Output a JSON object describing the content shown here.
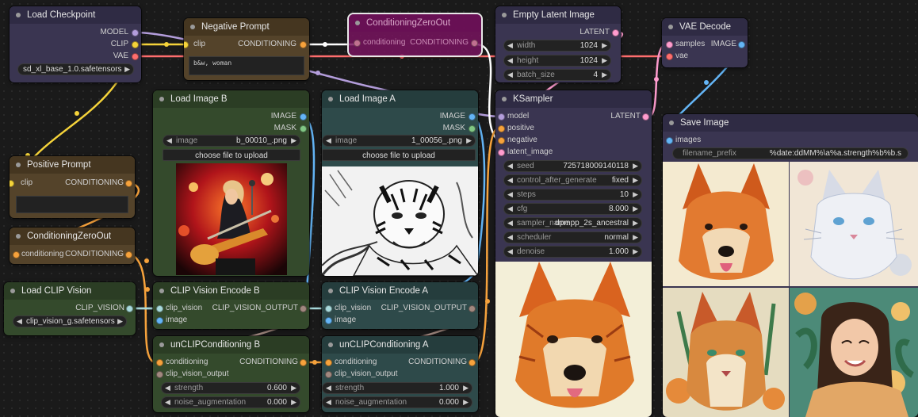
{
  "colors": {
    "clip": "#f5d33a",
    "conditioning": "#f6a23c",
    "model": "#b39ddb",
    "vae": "#ff6e6e",
    "latent": "#ff9ccf",
    "image": "#64b5f6",
    "mask": "#81c784",
    "clip_vision": "#a8dadc",
    "clip_vision_output": "#a1887f"
  },
  "load_checkpoint": {
    "title": "Load Checkpoint",
    "outputs": [
      "MODEL",
      "CLIP",
      "VAE"
    ],
    "ckpt_value": "sd_xl_base_1.0.safetensors"
  },
  "negative_prompt": {
    "title": "Negative Prompt",
    "input": "clip",
    "output": "CONDITIONING",
    "text": "b&w, woman"
  },
  "zero_out_top": {
    "title": "ConditioningZeroOut",
    "input": "conditioning",
    "output": "CONDITIONING"
  },
  "empty_latent": {
    "title": "Empty Latent Image",
    "output": "LATENT",
    "widgets": [
      {
        "name": "width",
        "value": "1024"
      },
      {
        "name": "height",
        "value": "1024"
      },
      {
        "name": "batch_size",
        "value": "4"
      }
    ]
  },
  "vae_decode": {
    "title": "VAE Decode",
    "inputs": [
      "samples",
      "vae"
    ],
    "output": "IMAGE"
  },
  "load_image_b": {
    "title": "Load Image B",
    "outputs": [
      "IMAGE",
      "MASK"
    ],
    "image_name": "image",
    "image_value": "b_00010_.png",
    "upload_label": "choose file to upload"
  },
  "load_image_a": {
    "title": "Load Image A",
    "outputs": [
      "IMAGE",
      "MASK"
    ],
    "image_name": "image",
    "image_value": "1_00056_.png",
    "upload_label": "choose file to upload"
  },
  "ksampler": {
    "title": "KSampler",
    "inputs": [
      "model",
      "positive",
      "negative",
      "latent_image"
    ],
    "output": "LATENT",
    "widgets": [
      {
        "name": "seed",
        "value": "725718009140118"
      },
      {
        "name": "control_after_generate",
        "value": "fixed"
      },
      {
        "name": "steps",
        "value": "10"
      },
      {
        "name": "cfg",
        "value": "8.000"
      },
      {
        "name": "sampler_name",
        "value": "dpmpp_2s_ancestral"
      },
      {
        "name": "scheduler",
        "value": "normal"
      },
      {
        "name": "denoise",
        "value": "1.000"
      }
    ]
  },
  "save_image": {
    "title": "Save Image",
    "input": "images",
    "prefix_name": "filename_prefix",
    "prefix_value": "%date:ddMM%\\a%a.strength%b%b.s"
  },
  "positive_prompt": {
    "title": "Positive Prompt",
    "input": "clip",
    "output": "CONDITIONING"
  },
  "zero_out_left": {
    "title": "ConditioningZeroOut",
    "input": "conditioning",
    "output": "CONDITIONING"
  },
  "load_clip_vision": {
    "title": "Load CLIP Vision",
    "output": "CLIP_VISION",
    "value": "clip_vision_g.safetensors"
  },
  "clip_vision_encode_b": {
    "title": "CLIP Vision Encode B",
    "inputs": [
      "clip_vision",
      "image"
    ],
    "output": "CLIP_VISION_OUTPUT"
  },
  "clip_vision_encode_a": {
    "title": "CLIP Vision Encode A",
    "inputs": [
      "clip_vision",
      "image"
    ],
    "output": "CLIP_VISION_OUTPUT"
  },
  "unclip_b": {
    "title": "unCLIPConditioning B",
    "inputs": [
      "conditioning",
      "clip_vision_output"
    ],
    "output": "CONDITIONING",
    "widgets": [
      {
        "name": "strength",
        "value": "0.600"
      },
      {
        "name": "noise_augmentation",
        "value": "0.000"
      }
    ]
  },
  "unclip_a": {
    "title": "unCLIPConditioning A",
    "inputs": [
      "conditioning",
      "clip_vision_output"
    ],
    "output": "CONDITIONING",
    "widgets": [
      {
        "name": "strength",
        "value": "1.000"
      },
      {
        "name": "noise_augmentation",
        "value": "0.000"
      }
    ]
  }
}
